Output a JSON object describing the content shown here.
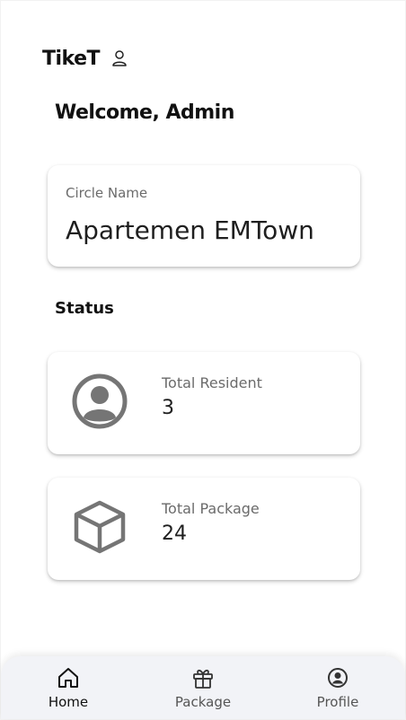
{
  "app": {
    "title": "TikeT"
  },
  "welcome": {
    "text": "Welcome, Admin"
  },
  "circle": {
    "label": "Circle Name",
    "value": "Apartemen EMTown"
  },
  "status": {
    "heading": "Status",
    "cards": [
      {
        "label": "Total Resident",
        "value": "3",
        "icon": "user-circle-icon"
      },
      {
        "label": "Total Package",
        "value": "24",
        "icon": "box-icon"
      }
    ]
  },
  "nav": {
    "items": [
      {
        "label": "Home",
        "icon": "home-icon",
        "active": true
      },
      {
        "label": "Package",
        "icon": "gift-icon",
        "active": false
      },
      {
        "label": "Profile",
        "icon": "profile-icon",
        "active": false
      }
    ]
  },
  "colors": {
    "icon_gray": "#757575",
    "label_gray": "#6b6b6b",
    "nav_bg": "#f2f3f7"
  }
}
